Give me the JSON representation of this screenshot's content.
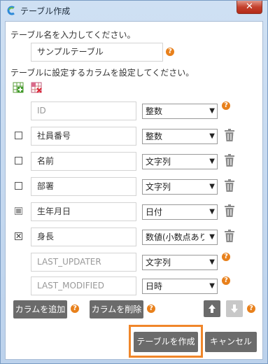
{
  "window": {
    "title": "テーブル作成",
    "close": "✕"
  },
  "labels": {
    "table_name_prompt": "テーブル名を入力してください。",
    "column_prompt": "テーブルに設定するカラムを設定してください。"
  },
  "table_name": {
    "value": "サンプルテーブル"
  },
  "columns": [
    {
      "name": "ID",
      "type": "整数",
      "placeholder_style": true
    },
    {
      "name": "社員番号",
      "type": "整数"
    },
    {
      "name": "名前",
      "type": "文字列"
    },
    {
      "name": "部署",
      "type": "文字列"
    },
    {
      "name": "生年月日",
      "type": "日付"
    },
    {
      "name": "身長",
      "type": "数値(小数点あり)"
    },
    {
      "name": "LAST_UPDATER",
      "type": "文字列",
      "placeholder_style": true
    },
    {
      "name": "LAST_MODIFIED",
      "type": "日時",
      "placeholder_style": true
    }
  ],
  "buttons": {
    "add_column": "カラムを追加",
    "delete_column": "カラムを削除",
    "create_table": "テーブルを作成",
    "cancel": "キャンセル"
  },
  "help_glyph": "?",
  "select_arrow": "▼",
  "checkbox_checked_glyph": "✕",
  "colors": {
    "accent_orange": "#f0862a",
    "button_gray": "#6b6b6b",
    "help_orange": "#e8801b"
  }
}
